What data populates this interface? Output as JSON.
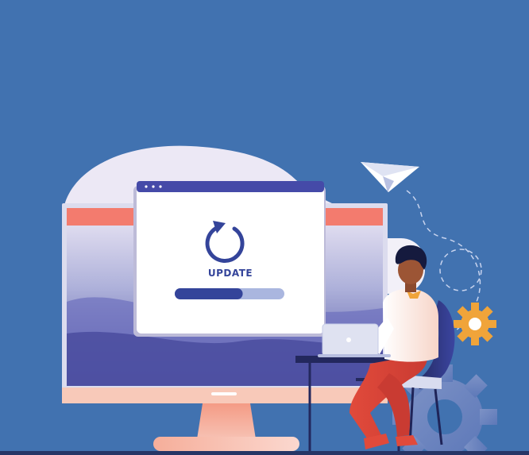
{
  "illustration": {
    "dialog_label": "UPDATE",
    "progress": 0.62,
    "icons": [
      "refresh-icon",
      "paper-plane-icon",
      "gear-icon",
      "laptop-icon"
    ],
    "colors": {
      "background": "#4172b0",
      "accent_dark": "#34449a",
      "accent_red": "#e8574a",
      "accent_orange": "#f0a43a"
    }
  }
}
